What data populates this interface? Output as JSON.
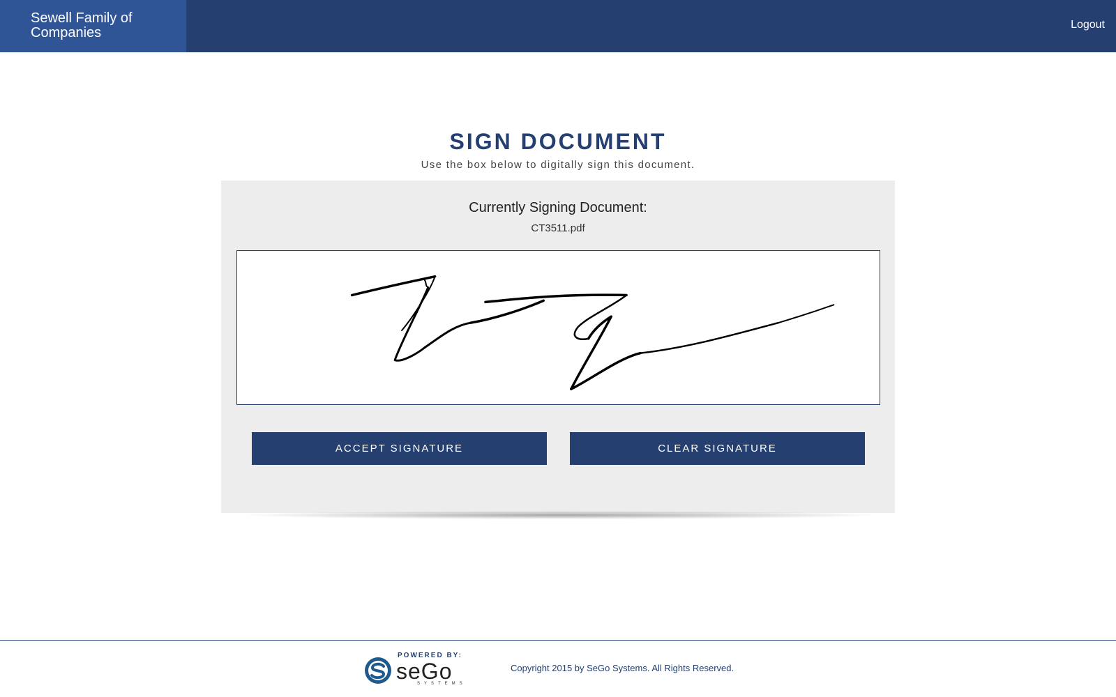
{
  "header": {
    "brand_title": "Sewell Family of Companies",
    "logout_label": "Logout",
    "bar_color": "#243f70",
    "brand_color": "#2f5597"
  },
  "page": {
    "title": "SIGN DOCUMENT",
    "subtitle": "Use the box below to digitally sign this document."
  },
  "card": {
    "heading": "Currently Signing Document:",
    "filename": "CT3511.pdf",
    "signature_icon": "handwritten-signature",
    "accept_label": "ACCEPT SIGNATURE",
    "clear_label": "CLEAR SIGNATURE"
  },
  "footer": {
    "powered_by": "POWERED BY:",
    "logo_word": "seGo",
    "logo_sub": "SYSTEMS",
    "logo_icon": "sego-logo-icon",
    "copyright": "Copyright 2015 by SeGo Systems. All Rights Reserved."
  },
  "colors": {
    "primary": "#243f70",
    "card_background": "#ededed"
  }
}
